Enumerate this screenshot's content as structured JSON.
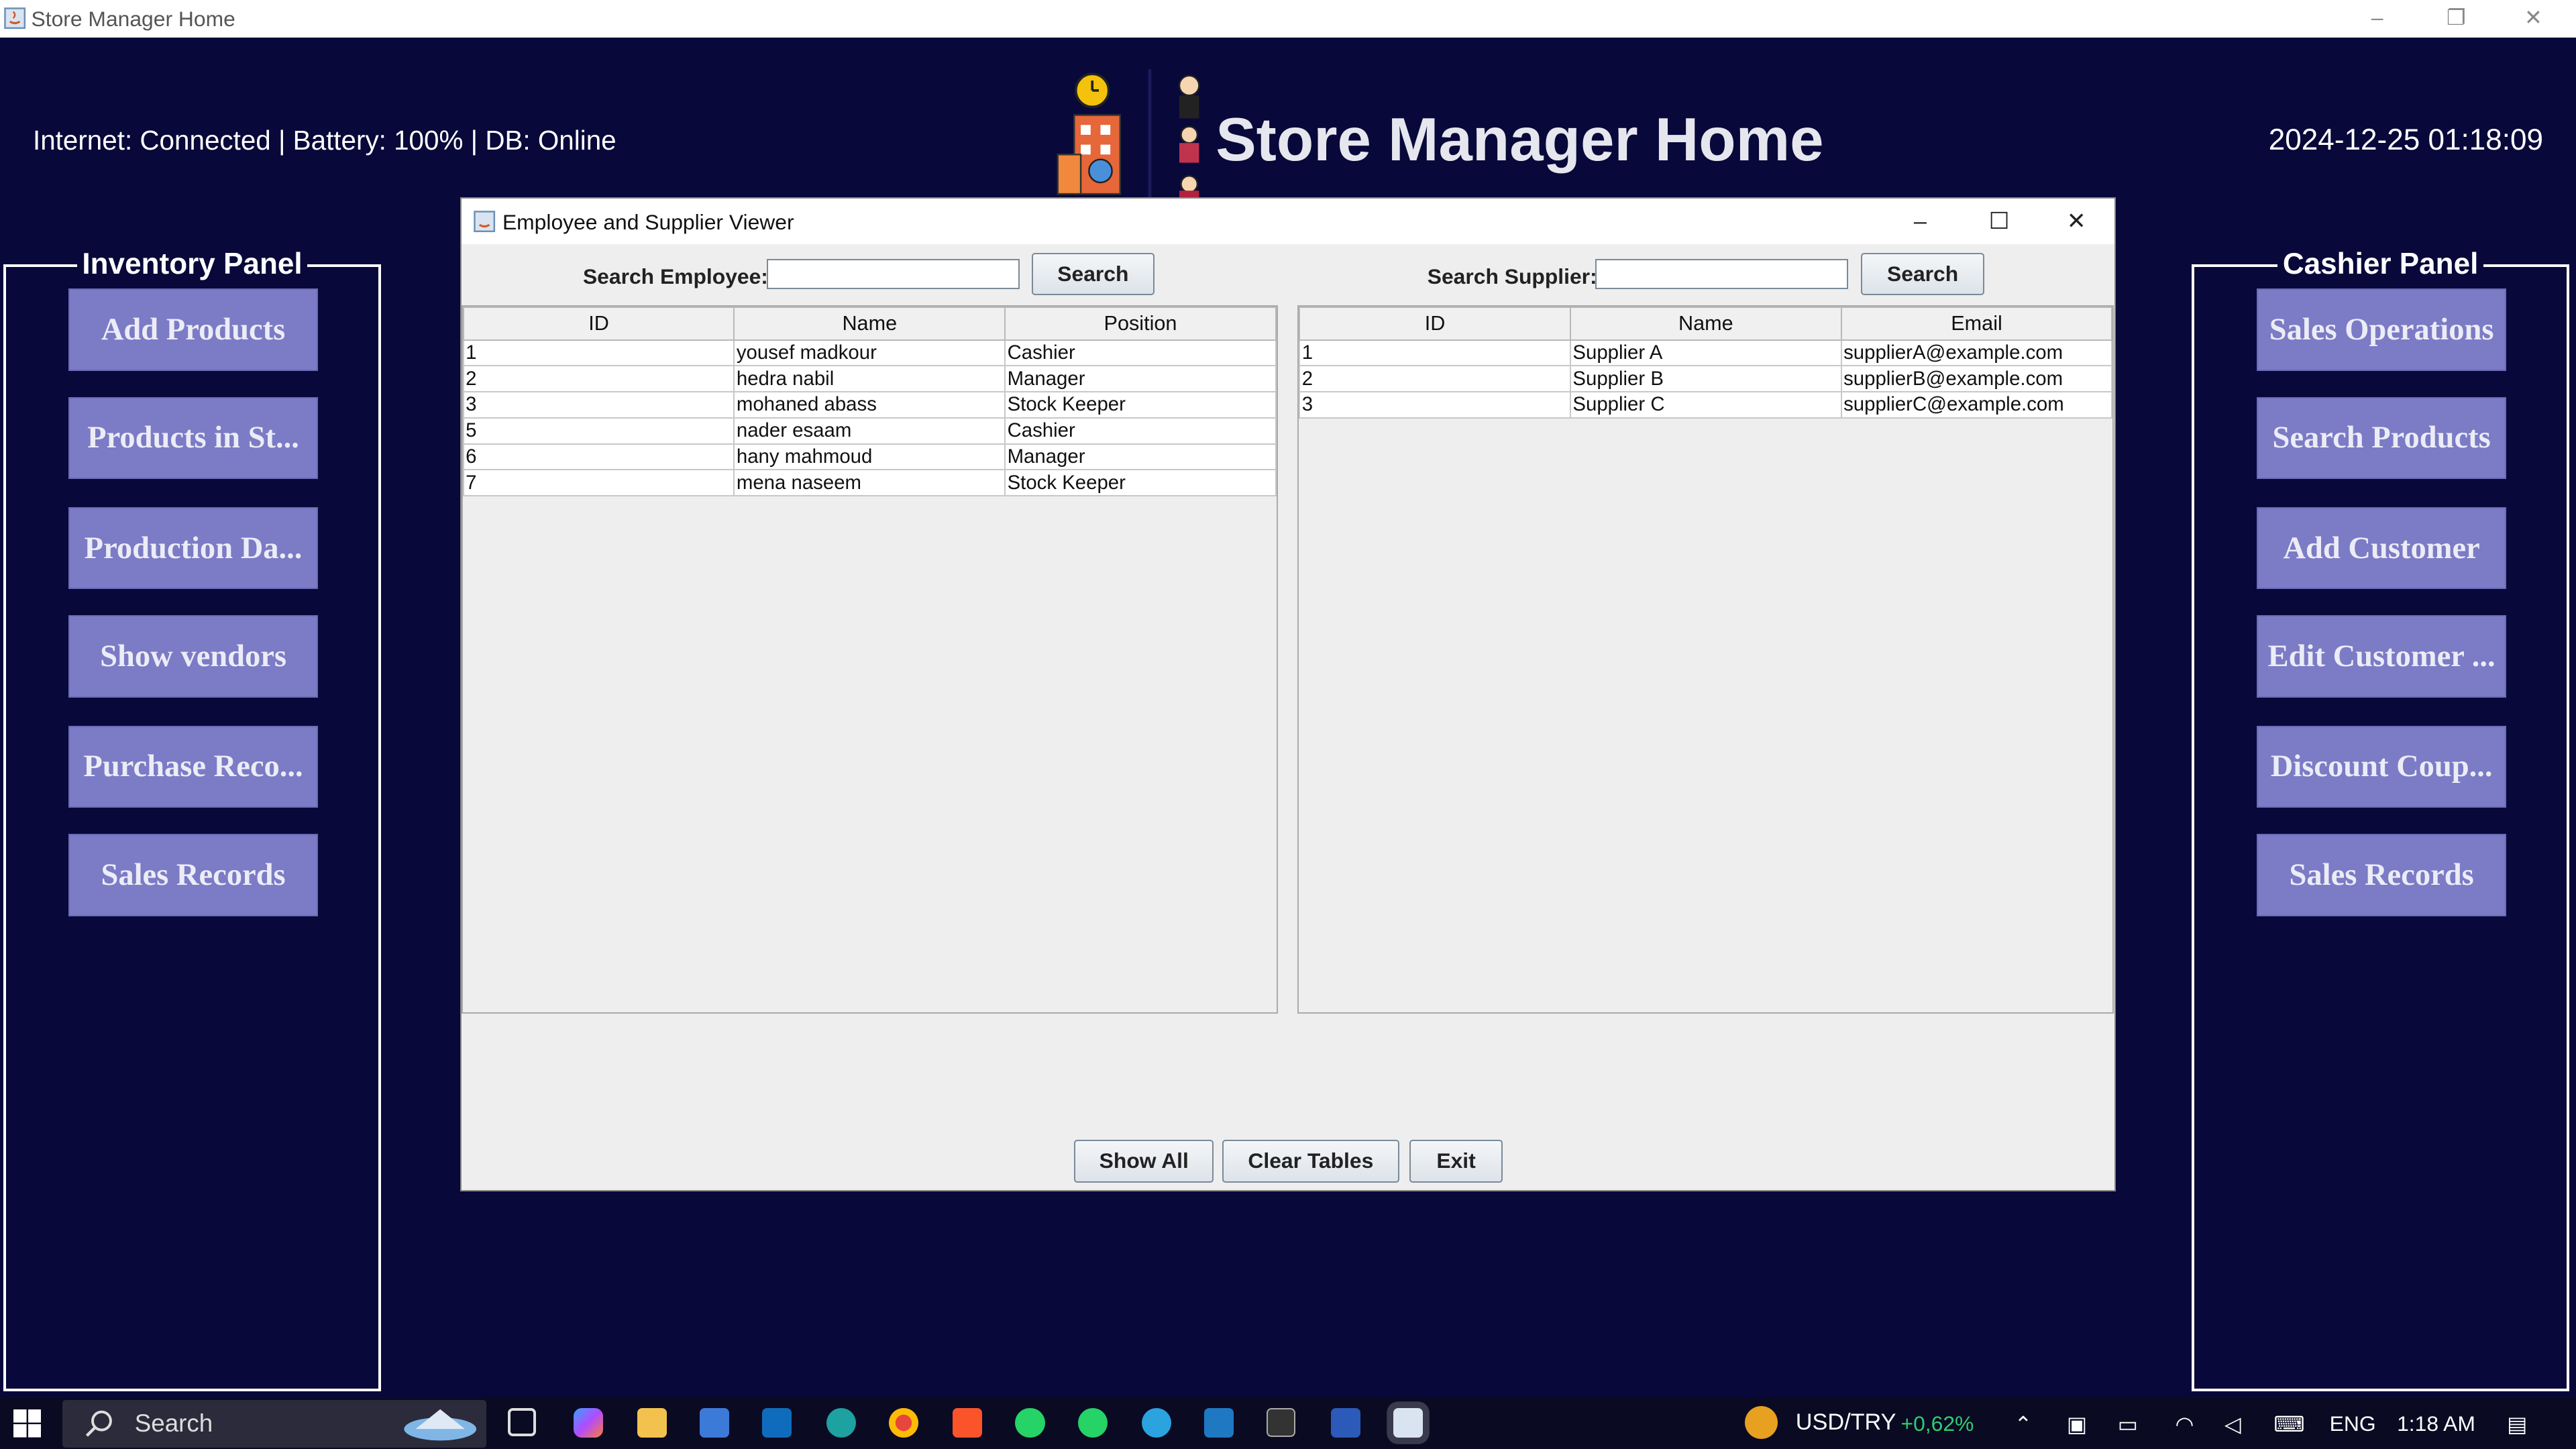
{
  "window": {
    "title": "Store Manager Home",
    "minimize": "–",
    "maximize": "❐",
    "close": "✕"
  },
  "header": {
    "status": "Internet: Connected | Battery: 100% | DB:  Online",
    "title": "Store Manager Home",
    "datetime": "2024-12-25 01:18:09"
  },
  "inventory_panel": {
    "title": "Inventory Panel",
    "buttons": [
      "Add Products",
      "Products in St...",
      "Production Da...",
      "Show vendors",
      "Purchase Reco...",
      "Sales Records"
    ]
  },
  "cashier_panel": {
    "title": "Cashier Panel",
    "buttons": [
      "Sales Operations",
      "Search Products",
      "Add Customer",
      "Edit Customer ...",
      "Discount Coup...",
      "Sales Records"
    ]
  },
  "dialog": {
    "title": "Employee and Supplier Viewer",
    "minimize": "–",
    "maximize": "☐",
    "close": "✕",
    "employee_search_label": "Search Employee:",
    "employee_search_value": "",
    "supplier_search_label": "Search Supplier:",
    "supplier_search_value": "",
    "search_button": "Search",
    "employee_table": {
      "columns": [
        "ID",
        "Name",
        "Position"
      ],
      "rows": [
        [
          "1",
          "yousef madkour",
          "Cashier"
        ],
        [
          "2",
          "hedra nabil",
          "Manager"
        ],
        [
          "3",
          "mohaned abass",
          "Stock Keeper"
        ],
        [
          "5",
          "nader esaam",
          "Cashier"
        ],
        [
          "6",
          "hany mahmoud",
          "Manager"
        ],
        [
          "7",
          "mena naseem",
          "Stock Keeper"
        ]
      ]
    },
    "supplier_table": {
      "columns": [
        "ID",
        "Name",
        "Email"
      ],
      "rows": [
        [
          "1",
          "Supplier A",
          "supplierA@example.com"
        ],
        [
          "2",
          "Supplier B",
          "supplierB@example.com"
        ],
        [
          "3",
          "Supplier C",
          "supplierC@example.com"
        ]
      ]
    },
    "buttons": {
      "show_all": "Show All",
      "clear_tables": "Clear Tables",
      "exit": "Exit"
    }
  },
  "taskbar": {
    "search_placeholder": "Search",
    "ticker": "USD/TRY",
    "ticker_change": "+0,62%",
    "language": "ENG",
    "time": "1:18 AM"
  },
  "colors": {
    "background": "#08083a",
    "side_button": "#7b7bc6",
    "ticker_positive": "#2ecc71"
  }
}
